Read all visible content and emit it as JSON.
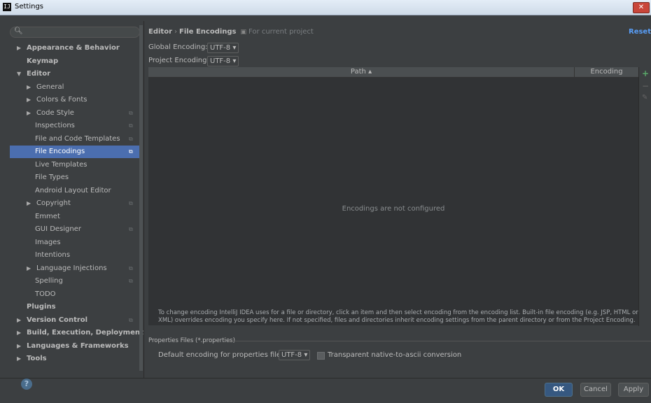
{
  "window": {
    "title": "Settings",
    "app_icon": "intellij-icon",
    "close_label": "✕"
  },
  "search": {
    "placeholder": "",
    "icon": "search-icon"
  },
  "sidebar": {
    "items": [
      {
        "label": "Appearance & Behavior",
        "bold": true,
        "arrow": true,
        "indent": 0,
        "copy": false
      },
      {
        "label": "Keymap",
        "bold": true,
        "arrow": false,
        "indent": 0,
        "copy": false
      },
      {
        "label": "Editor",
        "bold": true,
        "arrow": true,
        "expanded": true,
        "indent": 0,
        "copy": false
      },
      {
        "label": "General",
        "bold": false,
        "arrow": true,
        "indent": 1,
        "copy": false
      },
      {
        "label": "Colors & Fonts",
        "bold": false,
        "arrow": true,
        "indent": 1,
        "copy": false
      },
      {
        "label": "Code Style",
        "bold": false,
        "arrow": true,
        "indent": 1,
        "copy": true
      },
      {
        "label": "Inspections",
        "bold": false,
        "arrow": false,
        "indent": 1,
        "copy": true
      },
      {
        "label": "File and Code Templates",
        "bold": false,
        "arrow": false,
        "indent": 1,
        "copy": true
      },
      {
        "label": "File Encodings",
        "bold": false,
        "arrow": false,
        "indent": 1,
        "copy": true,
        "selected": true
      },
      {
        "label": "Live Templates",
        "bold": false,
        "arrow": false,
        "indent": 1,
        "copy": false
      },
      {
        "label": "File Types",
        "bold": false,
        "arrow": false,
        "indent": 1,
        "copy": false
      },
      {
        "label": "Android Layout Editor",
        "bold": false,
        "arrow": false,
        "indent": 1,
        "copy": false
      },
      {
        "label": "Copyright",
        "bold": false,
        "arrow": true,
        "indent": 1,
        "copy": true
      },
      {
        "label": "Emmet",
        "bold": false,
        "arrow": false,
        "indent": 1,
        "copy": false
      },
      {
        "label": "GUI Designer",
        "bold": false,
        "arrow": false,
        "indent": 1,
        "copy": true
      },
      {
        "label": "Images",
        "bold": false,
        "arrow": false,
        "indent": 1,
        "copy": false
      },
      {
        "label": "Intentions",
        "bold": false,
        "arrow": false,
        "indent": 1,
        "copy": false
      },
      {
        "label": "Language Injections",
        "bold": false,
        "arrow": true,
        "indent": 1,
        "copy": true
      },
      {
        "label": "Spelling",
        "bold": false,
        "arrow": false,
        "indent": 1,
        "copy": true
      },
      {
        "label": "TODO",
        "bold": false,
        "arrow": false,
        "indent": 1,
        "copy": false
      },
      {
        "label": "Plugins",
        "bold": true,
        "arrow": false,
        "indent": 0,
        "copy": false
      },
      {
        "label": "Version Control",
        "bold": true,
        "arrow": true,
        "indent": 0,
        "copy": true
      },
      {
        "label": "Build, Execution, Deployment",
        "bold": true,
        "arrow": true,
        "indent": 0,
        "copy": false
      },
      {
        "label": "Languages & Frameworks",
        "bold": true,
        "arrow": true,
        "indent": 0,
        "copy": false
      },
      {
        "label": "Tools",
        "bold": true,
        "arrow": true,
        "indent": 0,
        "copy": false
      }
    ]
  },
  "header": {
    "crumb1": "Editor",
    "separator": "›",
    "crumb2": "File Encodings",
    "project_note": "For current project",
    "reset_label": "Reset"
  },
  "encoding": {
    "global_label": "Global Encoding:",
    "global_value": "UTF-8",
    "project_label": "Project Encoding:",
    "project_value": "UTF-8"
  },
  "table": {
    "col_path": "Path",
    "col_encoding": "Encoding",
    "empty_message": "Encodings are not configured",
    "tools": {
      "add": "+",
      "remove": "−",
      "edit": "✎"
    }
  },
  "help_text": "To change encoding IntelliJ IDEA uses for a file or directory, click an item and then select encoding from the encoding list. Built-in file encoding (e.g. JSP, HTML or XML) overrides encoding you specify here. If not specified, files and directories inherit encoding settings from the parent directory or from the Project Encoding.",
  "properties": {
    "title": "Properties Files (*.properties)",
    "default_label": "Default encoding for properties files:",
    "default_value": "UTF-8",
    "transparent_label": "Transparent native-to-ascii conversion",
    "transparent_checked": false
  },
  "footer": {
    "help": "?",
    "ok": "OK",
    "cancel": "Cancel",
    "apply": "Apply"
  },
  "colors": {
    "selection": "#4b6eaf",
    "accent_link": "#589df6",
    "add_green": "#59a869",
    "primary_button": "#365880"
  }
}
